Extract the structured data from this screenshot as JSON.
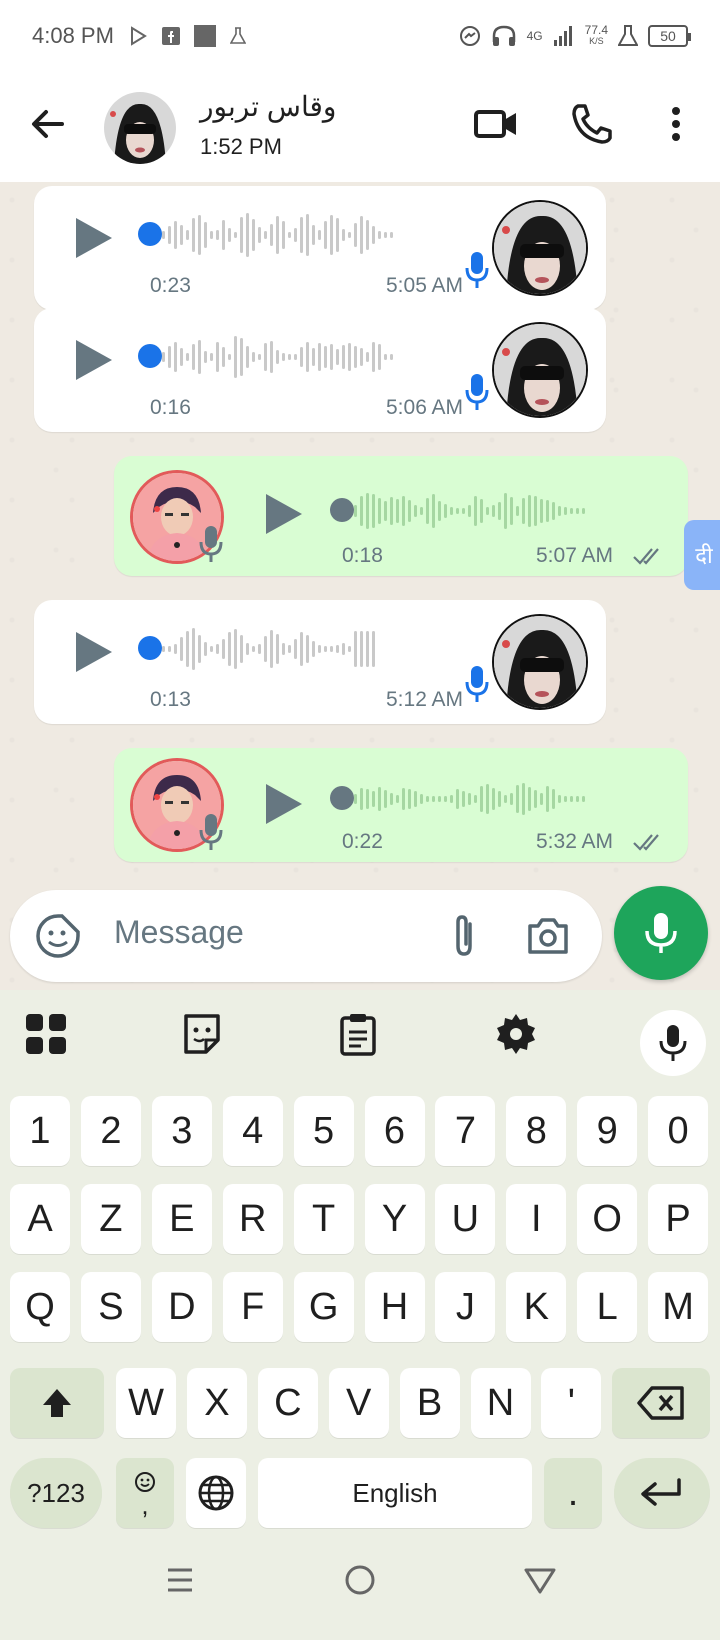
{
  "status_bar": {
    "time": "4:08 PM",
    "network": "4G",
    "speed": "77.4",
    "speed_unit": "K/S",
    "battery": "50"
  },
  "header": {
    "contact_name": "وقاس تربور",
    "contact_status": "1:52 PM"
  },
  "messages": [
    {
      "direction": "in",
      "duration": "0:23",
      "time": "5:05 AM"
    },
    {
      "direction": "in",
      "duration": "0:16",
      "time": "5:06 AM"
    },
    {
      "direction": "out",
      "duration": "0:18",
      "time": "5:07 AM"
    },
    {
      "direction": "in",
      "duration": "0:13",
      "time": "5:12 AM"
    },
    {
      "direction": "out",
      "duration": "0:22",
      "time": "5:32 AM"
    }
  ],
  "translate_fab": {
    "label": "दी"
  },
  "composer": {
    "placeholder": "Message"
  },
  "keyboard": {
    "row_numbers": [
      "1",
      "2",
      "3",
      "4",
      "5",
      "6",
      "7",
      "8",
      "9",
      "0"
    ],
    "row1": [
      "A",
      "Z",
      "E",
      "R",
      "T",
      "Y",
      "U",
      "I",
      "O",
      "P"
    ],
    "row2": [
      "Q",
      "S",
      "D",
      "F",
      "G",
      "H",
      "J",
      "K",
      "L",
      "M"
    ],
    "row3": [
      "W",
      "X",
      "C",
      "V",
      "B",
      "N",
      "'"
    ],
    "symbols_label": "?123",
    "emoji_comma_label": ",",
    "space_label": "English",
    "period_label": "."
  },
  "colors": {
    "accent_green": "#1ea55b",
    "outgoing_bubble": "#d9fdd3",
    "incoming_bubble": "#ffffff",
    "chat_bg": "#efeae2",
    "unplayed_dot": "#1a73e8",
    "played_dot": "#667781"
  }
}
